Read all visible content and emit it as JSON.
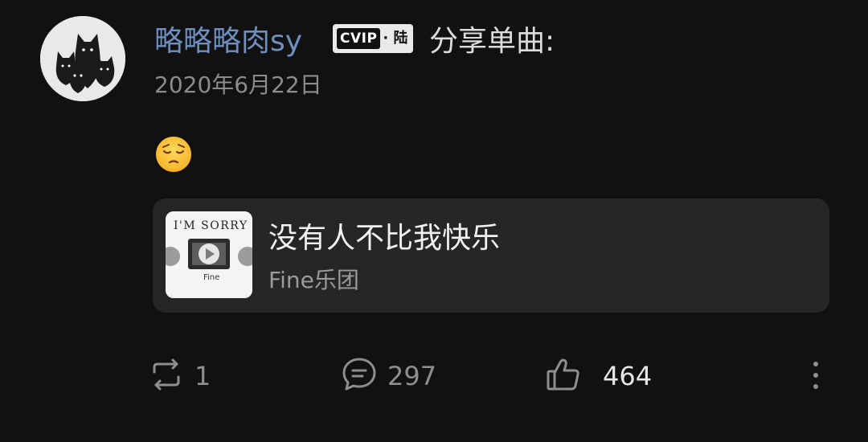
{
  "post": {
    "username": "略略略肉sy",
    "vip_badge": {
      "mark": "CVIP",
      "level": "· 陆"
    },
    "action_text": "分享单曲:",
    "timestamp": "2020年6月22日",
    "emoji": "pensive-face",
    "colors": {
      "background": "#111112",
      "username": "#6f8fbf",
      "card": "#262627"
    }
  },
  "music_card": {
    "title": "没有人不比我快乐",
    "artist": "Fine乐团",
    "album_art": {
      "text_top": "I'M SORRY",
      "text_bottom": "Fine"
    }
  },
  "actions": {
    "repost": {
      "icon": "repost-icon",
      "count": "1"
    },
    "comment": {
      "icon": "comment-icon",
      "count": "297"
    },
    "like": {
      "icon": "thumbs-up-icon",
      "count": "464"
    },
    "more": {
      "icon": "more-vertical-icon"
    }
  }
}
